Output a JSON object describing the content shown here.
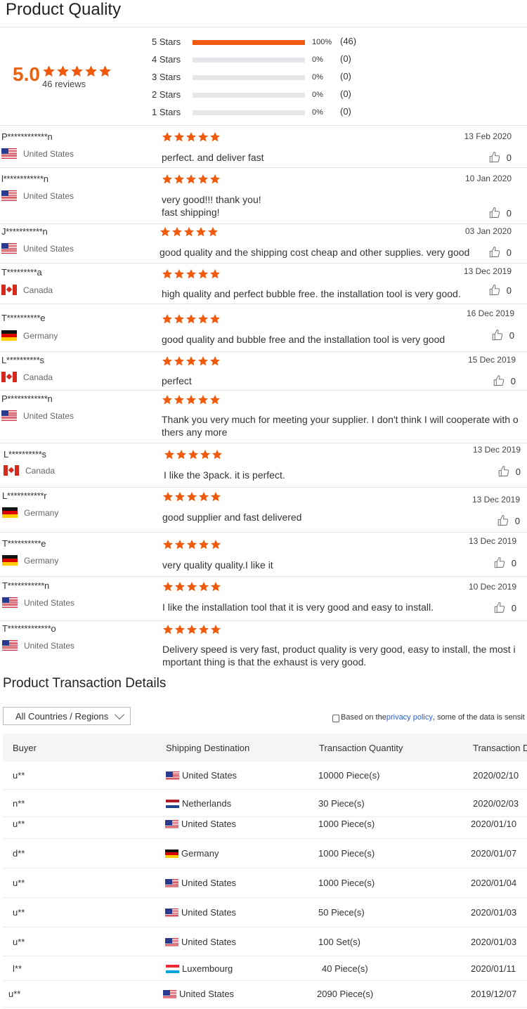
{
  "product_quality": {
    "title": "Product Quality",
    "score": "5.0",
    "reviews_count": "46 reviews",
    "distribution": [
      {
        "label": "5 Stars",
        "fraction": 1.0,
        "pct": "100%",
        "count": "(46)"
      },
      {
        "label": "4 Stars",
        "fraction": 0,
        "pct": "0%",
        "count": "(0)"
      },
      {
        "label": "3 Stars",
        "fraction": 0,
        "pct": "0%",
        "count": "(0)"
      },
      {
        "label": "2 Stars",
        "fraction": 0,
        "pct": "0%",
        "count": "(0)"
      },
      {
        "label": "1 Stars",
        "fraction": 0,
        "pct": "0%",
        "count": "(0)"
      }
    ],
    "star_color": "#ef5a0c",
    "score_color": "#e8620f"
  },
  "reviews": [
    {
      "name": "P************n",
      "country": "United States",
      "flag": "us",
      "rating": 5,
      "date": "13 Feb 2020",
      "text": "perfect. and  deliver fast",
      "likes": "0"
    },
    {
      "name": "l************n",
      "country": "United States",
      "flag": "us",
      "rating": 5,
      "date": "10 Jan 2020",
      "text": "very good!!! thank you!\nfast shipping!",
      "likes": "0"
    },
    {
      "name": "J***********n",
      "country": "United States",
      "flag": "us",
      "rating": 5,
      "date": "03 Jan 2020",
      "text": "good quality and the shipping cost cheap and other supplies. very good",
      "likes": "0"
    },
    {
      "name": "T*********a",
      "country": "Canada",
      "flag": "ca",
      "rating": 5,
      "date": "13 Dec 2019",
      "text": "high quality and perfect bubble free. the installation tool is very good.",
      "likes": "0"
    },
    {
      "name": "T**********e",
      "country": "Germany",
      "flag": "de",
      "rating": 5,
      "date": "16 Dec 2019",
      "text": "good quality and bubble free and the installation tool is very good",
      "likes": "0"
    },
    {
      "name": "L**********s",
      "country": "Canada",
      "flag": "ca",
      "rating": 5,
      "date": "15 Dec 2019",
      "text": "perfect",
      "likes": "0"
    },
    {
      "name": "P************n",
      "country": "United States",
      "flag": "us",
      "rating": 5,
      "date": "",
      "text": "Thank you very much for meeting your supplier. I don't think I will cooperate with o\nthers any more",
      "likes": ""
    },
    {
      "name": "L**********s",
      "country": "Canada",
      "flag": "ca",
      "rating": 5,
      "date": "13 Dec 2019",
      "text": "I like the 3pack.  it is perfect.",
      "likes": "0"
    },
    {
      "name": "L***********r",
      "country": "Germany",
      "flag": "de",
      "rating": 5,
      "date": "13 Dec 2019",
      "text": "good supplier and fast delivered",
      "likes": "0"
    },
    {
      "name": "T**********e",
      "country": "Germany",
      "flag": "de",
      "rating": 5,
      "date": "13 Dec 2019",
      "text": "very quality quality.I like it",
      "likes": "0"
    },
    {
      "name": "T***********n",
      "country": "United States",
      "flag": "us",
      "rating": 5,
      "date": "10 Dec 2019",
      "text": "I like the installation tool that it is very good and easy to install.",
      "likes": "0"
    },
    {
      "name": "T*************o",
      "country": "United States",
      "flag": "us",
      "rating": 5,
      "date": "",
      "text": "Delivery speed is very fast, product quality is very good, easy to install, the most i\nmportant thing is that the exhaust is very good.",
      "likes": ""
    }
  ],
  "transactions": {
    "title": "Product Transaction Details",
    "filter_value": "All Countries / Regions",
    "privacy_prefix": "Based on the ",
    "privacy_link": "privacy policy",
    "privacy_suffix": ", some of the data is sensit",
    "columns": [
      "Buyer",
      "Shipping Destination",
      "Transaction Quantity",
      "Transaction D"
    ],
    "rows": [
      {
        "buyer": "u**",
        "destination": "United States",
        "flag": "us",
        "quantity": "10000 Piece(s)",
        "date": "2020/02/10"
      },
      {
        "buyer": "n**",
        "destination": "Netherlands",
        "flag": "nl",
        "quantity": "30 Piece(s)",
        "date": "2020/02/03"
      },
      {
        "buyer": "u**",
        "destination": "United States",
        "flag": "us",
        "quantity": "1000 Piece(s)",
        "date": "2020/01/10"
      },
      {
        "buyer": "d**",
        "destination": "Germany",
        "flag": "de",
        "quantity": "1000 Piece(s)",
        "date": "2020/01/07"
      },
      {
        "buyer": "u**",
        "destination": "United States",
        "flag": "us",
        "quantity": "1000 Piece(s)",
        "date": "2020/01/04"
      },
      {
        "buyer": "u**",
        "destination": "United States",
        "flag": "us",
        "quantity": "50 Piece(s)",
        "date": "2020/01/03"
      },
      {
        "buyer": "u**",
        "destination": "United States",
        "flag": "us",
        "quantity": "100 Set(s)",
        "date": "2020/01/03"
      },
      {
        "buyer": "l**",
        "destination": "Luxembourg",
        "flag": "lu",
        "quantity": "40 Piece(s)",
        "date": "2020/01/11"
      },
      {
        "buyer": "u**",
        "destination": "United States",
        "flag": "us",
        "quantity": "2090 Piece(s)",
        "date": "2019/12/07"
      }
    ]
  }
}
